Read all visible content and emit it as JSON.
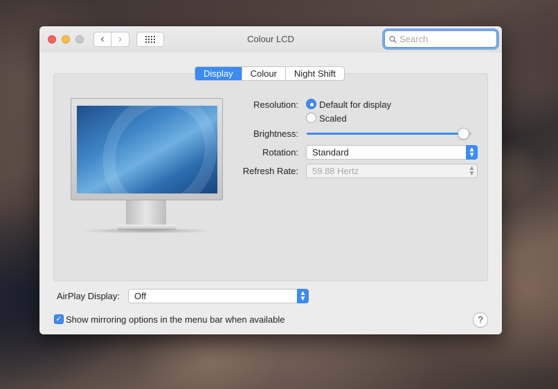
{
  "window": {
    "title": "Colour LCD"
  },
  "toolbar": {
    "back_icon": "chevron-left-icon",
    "forward_icon": "chevron-right-icon",
    "grid_icon": "grid-icon"
  },
  "search": {
    "placeholder": "Search",
    "value": ""
  },
  "tabs": [
    {
      "label": "Display",
      "active": true
    },
    {
      "label": "Colour",
      "active": false
    },
    {
      "label": "Night Shift",
      "active": false
    }
  ],
  "display": {
    "resolution_label": "Resolution:",
    "resolution_options": [
      {
        "label": "Default for display",
        "selected": true
      },
      {
        "label": "Scaled",
        "selected": false
      }
    ],
    "brightness_label": "Brightness:",
    "brightness_level": 0.95,
    "rotation_label": "Rotation:",
    "rotation_value": "Standard",
    "refresh_label": "Refresh Rate:",
    "refresh_value": "59.88 Hertz"
  },
  "airplay": {
    "label": "AirPlay Display:",
    "value": "Off"
  },
  "mirroring": {
    "label": "Show mirroring options in the menu bar when available",
    "checked": true
  },
  "help_label": "?",
  "colors": {
    "accent": "#3b8bf0",
    "close": "#fc605c",
    "minimize": "#fdbc40",
    "zoom_inactive": "#c8c8c8"
  }
}
